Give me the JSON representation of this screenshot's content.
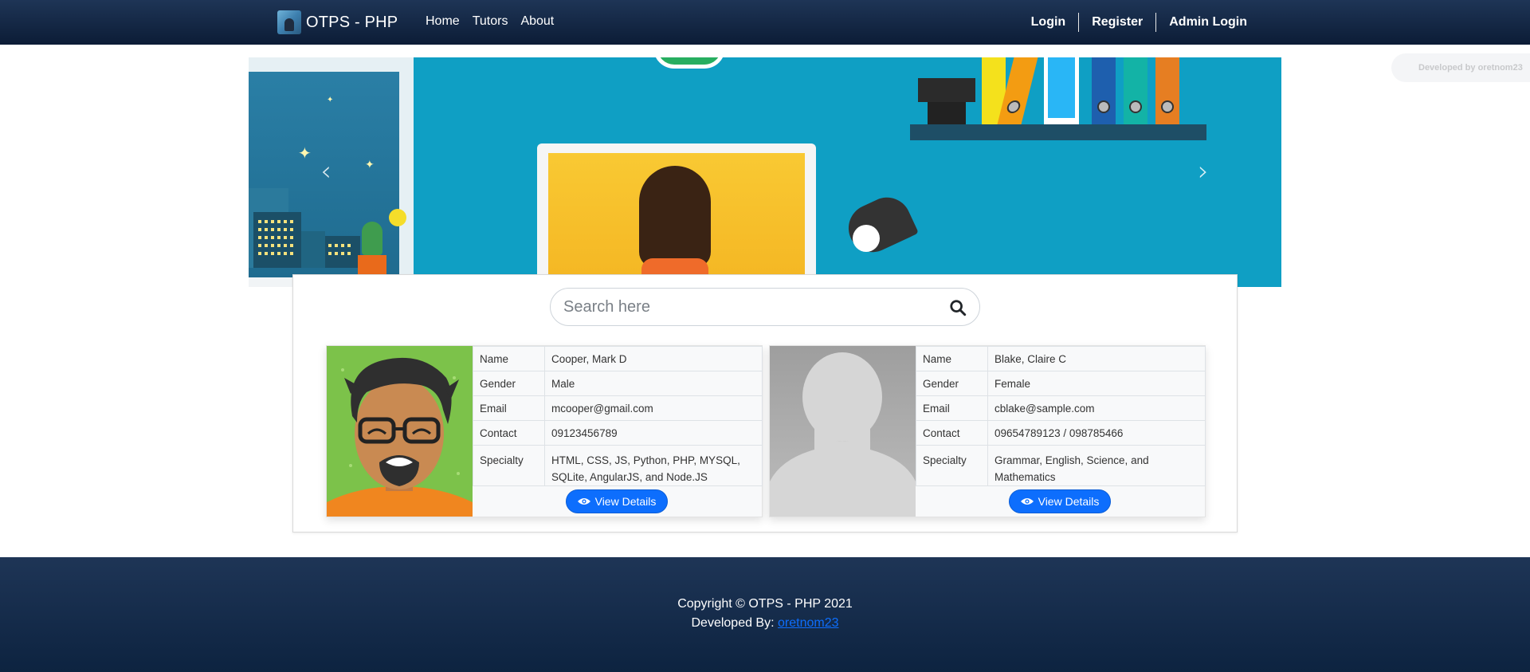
{
  "navbar": {
    "brand": "OTPS - PHP",
    "links": [
      "Home",
      "Tutors",
      "About"
    ],
    "right": [
      "Login",
      "Register",
      "Admin Login"
    ]
  },
  "dev_badge": "Developed by oretnom23",
  "carousel": {
    "prev": "‹",
    "next": "›"
  },
  "search": {
    "placeholder": "Search here"
  },
  "tutors": [
    {
      "labels": [
        "Name",
        "Gender",
        "Email",
        "Contact",
        "Specialty"
      ],
      "name": "Cooper, Mark D",
      "gender": "Male",
      "email": "mcooper@gmail.com",
      "contact": "09123456789",
      "specialty": "HTML, CSS, JS, Python, PHP, MYSQL, SQLite, AngularJS, and Node.JS",
      "button": "View Details"
    },
    {
      "labels": [
        "Name",
        "Gender",
        "Email",
        "Contact",
        "Specialty"
      ],
      "name": "Blake, Claire C",
      "gender": "Female",
      "email": "cblake@sample.com",
      "contact": "09654789123 / 098785466",
      "specialty": "Grammar, English, Science, and Mathematics",
      "button": "View Details"
    }
  ],
  "footer": {
    "copyright": "Copyright © OTPS - PHP 2021",
    "developed_by": "Developed By: ",
    "developer_link": "oretnom23"
  }
}
